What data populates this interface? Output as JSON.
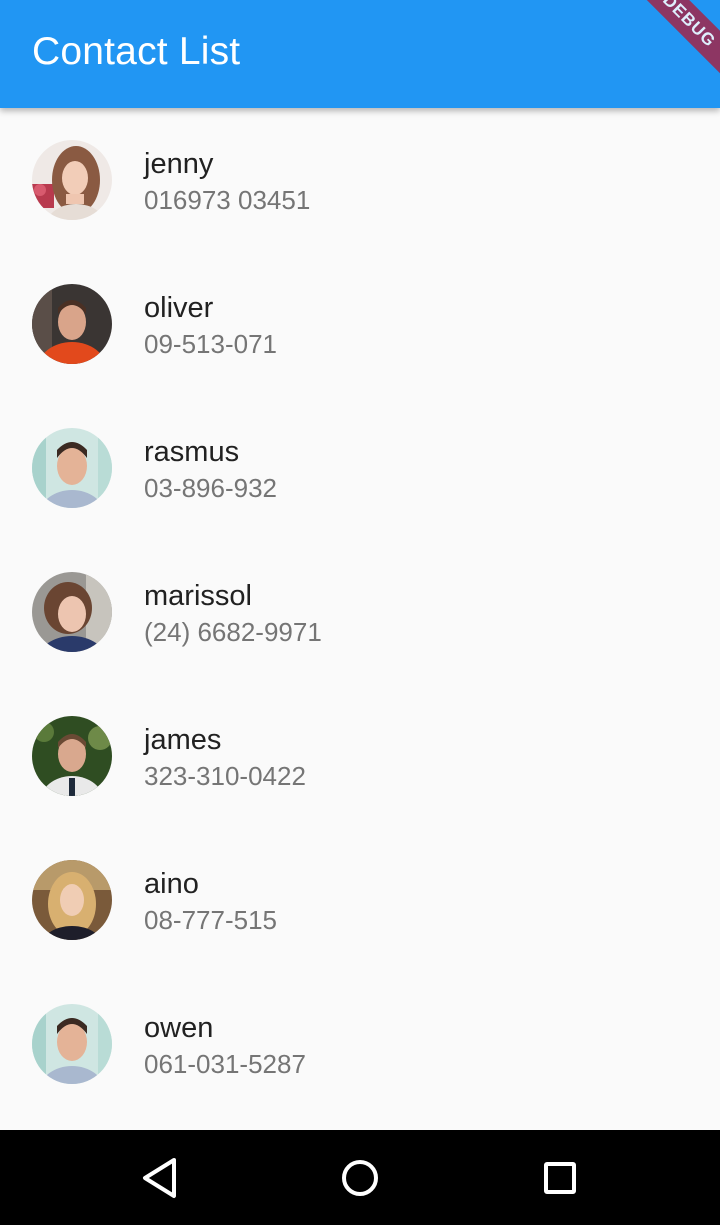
{
  "app_bar": {
    "title": "Contact List",
    "debug_banner": "DEBUG",
    "color": "#2196f3"
  },
  "contacts": [
    {
      "name": "jenny",
      "phone": "016973 03451",
      "avatar": "jenny-photo"
    },
    {
      "name": "oliver",
      "phone": "09-513-071",
      "avatar": "oliver-photo"
    },
    {
      "name": "rasmus",
      "phone": "03-896-932",
      "avatar": "rasmus-photo"
    },
    {
      "name": "marissol",
      "phone": "(24) 6682-9971",
      "avatar": "marissol-photo"
    },
    {
      "name": "james",
      "phone": "323-310-0422",
      "avatar": "james-photo"
    },
    {
      "name": "aino",
      "phone": "08-777-515",
      "avatar": "aino-photo"
    },
    {
      "name": "owen",
      "phone": "061-031-5287",
      "avatar": "owen-photo"
    }
  ],
  "nav_bar": {
    "buttons": [
      "back-icon",
      "home-icon",
      "recents-icon"
    ]
  }
}
